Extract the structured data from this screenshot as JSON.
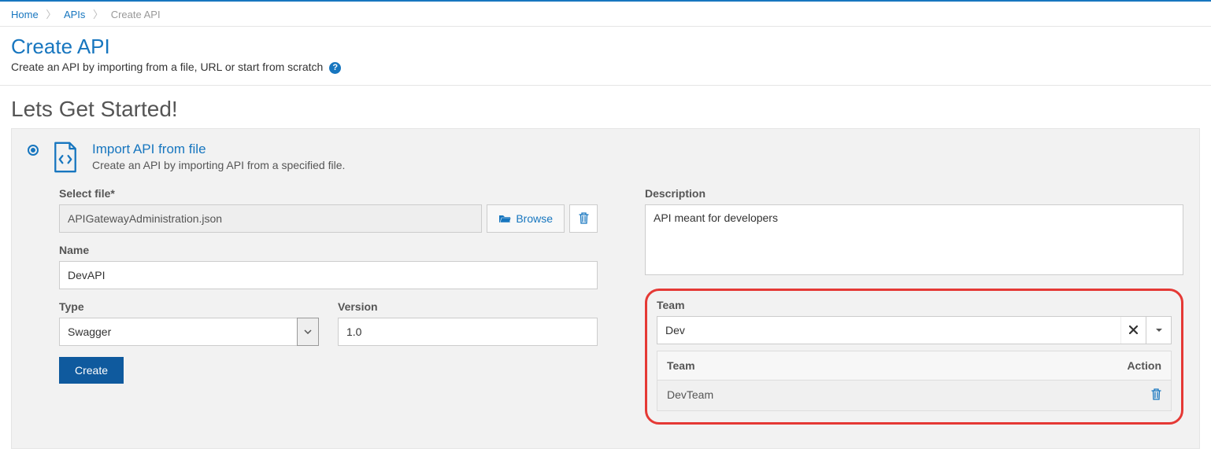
{
  "breadcrumb": {
    "home": "Home",
    "apis": "APIs",
    "current": "Create API"
  },
  "header": {
    "title": "Create API",
    "subtitle": "Create an API by importing from a file, URL or start from scratch"
  },
  "section_title": "Lets Get Started!",
  "option": {
    "title": "Import API from file",
    "desc": "Create an API by importing API from a specified file."
  },
  "labels": {
    "select_file": "Select file*",
    "browse": "Browse",
    "name": "Name",
    "type": "Type",
    "version": "Version",
    "description": "Description",
    "team": "Team",
    "team_col": "Team",
    "action_col": "Action"
  },
  "values": {
    "file": "APIGatewayAdministration.json",
    "name": "DevAPI",
    "type": "Swagger",
    "version": "1.0",
    "description": "API meant for developers",
    "team_search": "Dev"
  },
  "buttons": {
    "create": "Create"
  },
  "team_rows": [
    {
      "name": "DevTeam"
    }
  ]
}
